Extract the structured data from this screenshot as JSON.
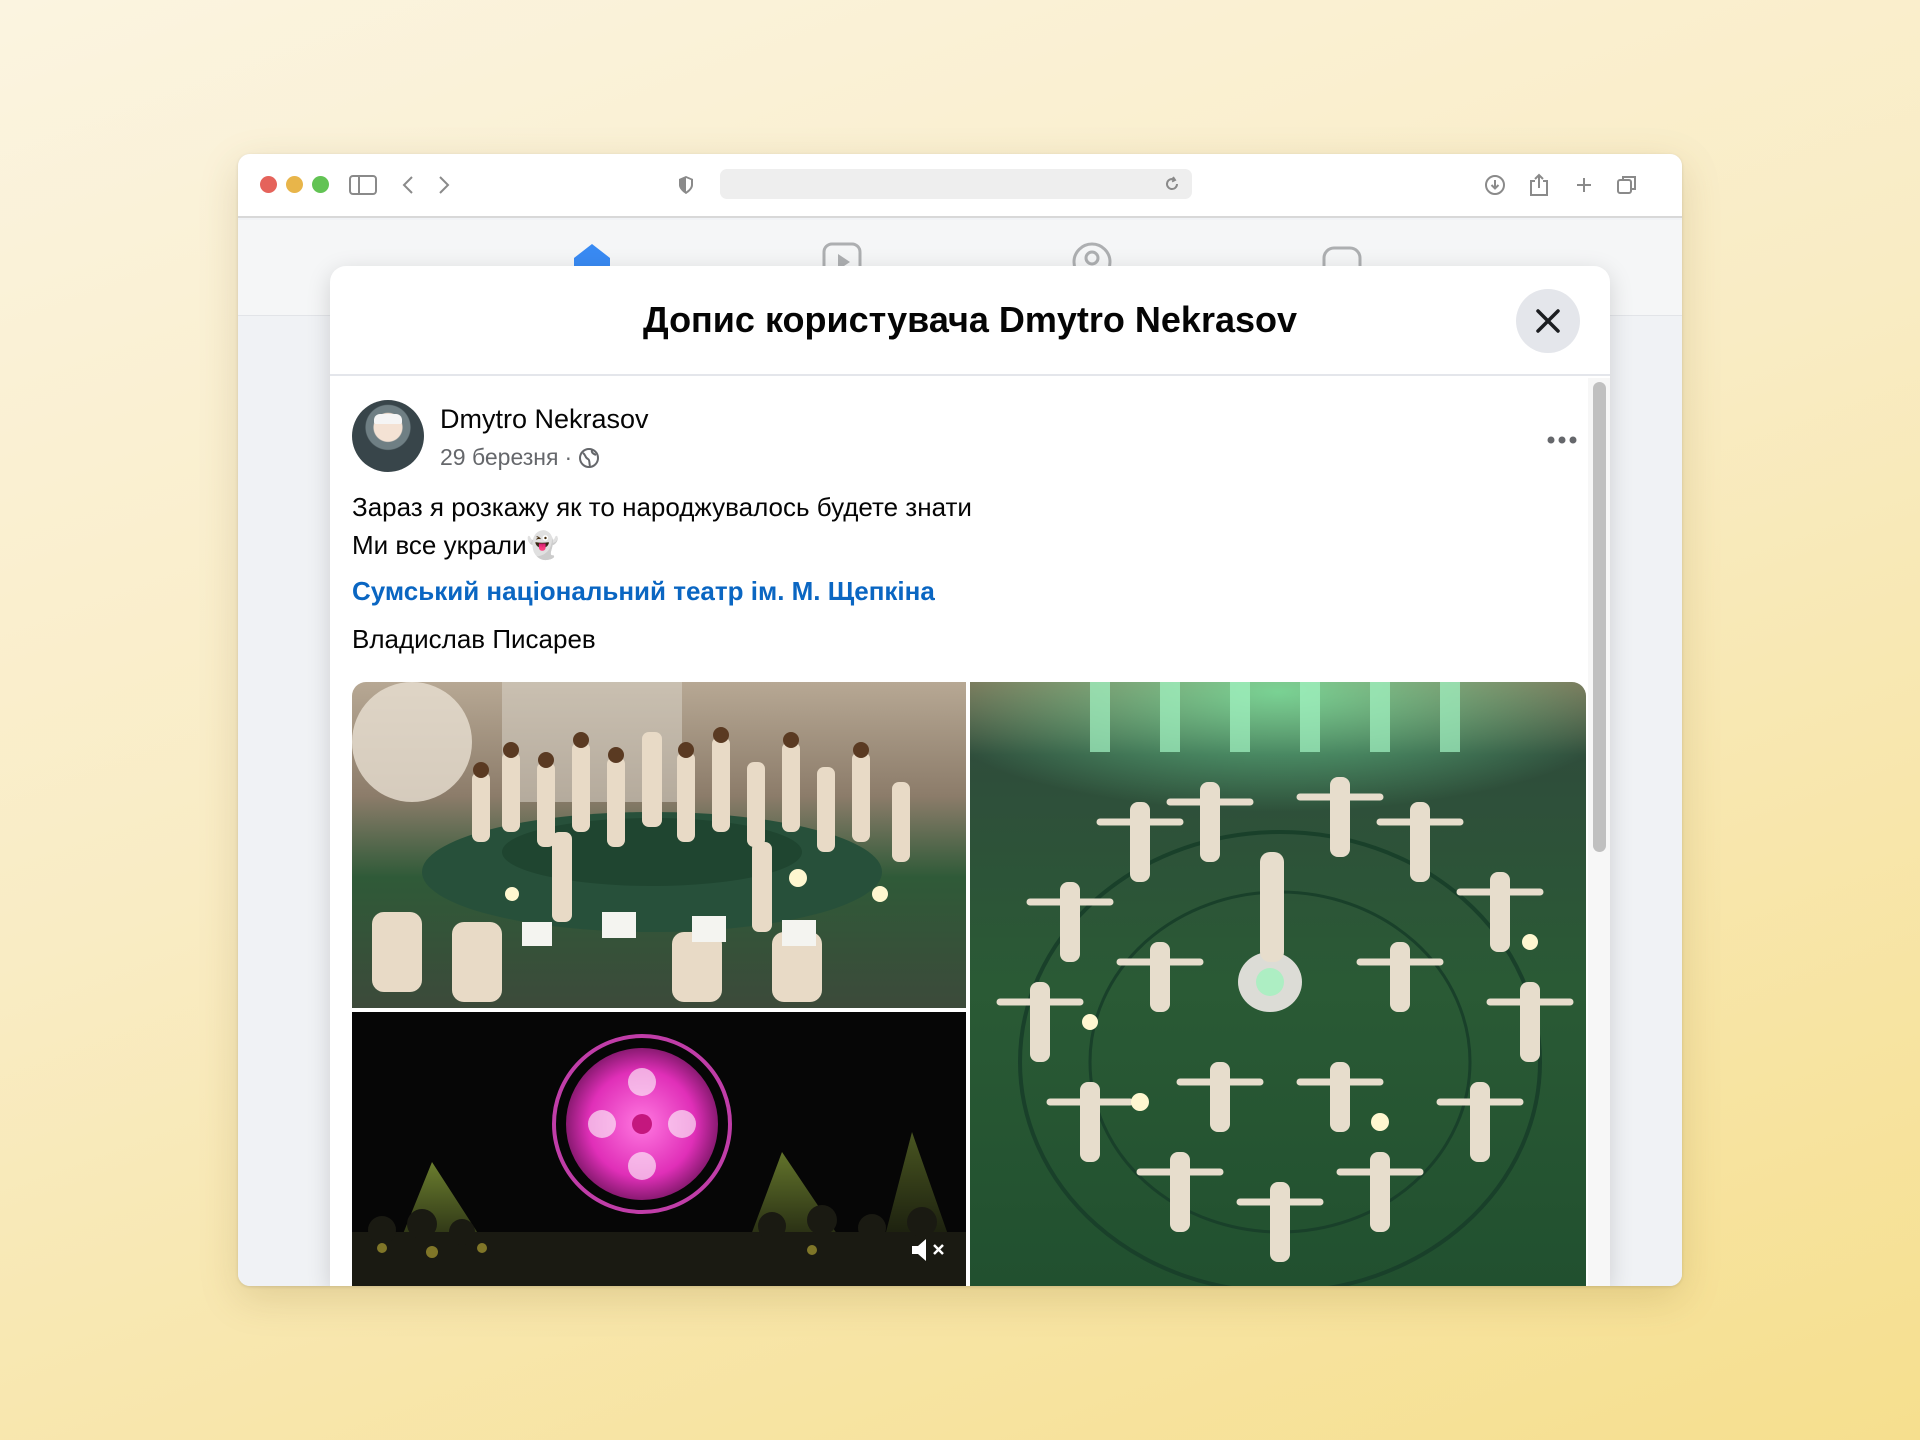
{
  "browser": {
    "url_text": ""
  },
  "modal": {
    "title": "Допис користувача Dmytro Nekrasov"
  },
  "post": {
    "author": "Dmytro Nekrasov",
    "date": "29 березня",
    "separator": "·",
    "text_line_1": "Зараз я розкажу як то народжувалось будете знати",
    "text_line_2": "Ми все украли",
    "text_emoji": "👻",
    "link": "Сумський національний театр ім. М. Щепкіна",
    "tag": "Владислав Писарев"
  },
  "icons": {
    "globe": "globe-icon",
    "more": "more-options-icon",
    "close": "close-icon",
    "mute": "mute-icon"
  },
  "colors": {
    "link": "#0a66c2",
    "fb_nav_active": "#1877f2"
  }
}
